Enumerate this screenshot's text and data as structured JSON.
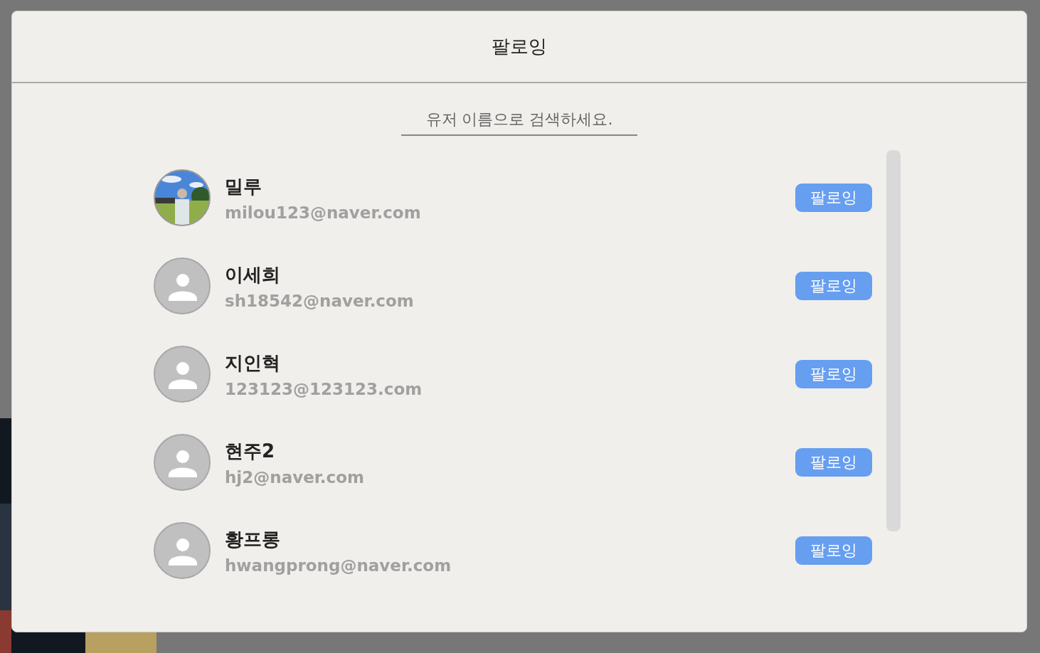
{
  "dialog": {
    "title": "팔로잉"
  },
  "search": {
    "placeholder": "유저 이름으로 검색하세요."
  },
  "users": [
    {
      "name": "밀루",
      "email": "milou123@naver.com",
      "button": "팔로잉"
    },
    {
      "kind": "default",
      "name": "이세희",
      "email": "sh18542@naver.com",
      "button": "팔로잉"
    },
    {
      "kind": "default",
      "name": "지인혁",
      "email": "123123@123123.com",
      "button": "팔로잉"
    },
    {
      "kind": "default",
      "name": "현주2",
      "email": "hj2@naver.com",
      "button": "팔로잉"
    },
    {
      "kind": "default",
      "name": "황프롱",
      "email": "hwangprong@naver.com",
      "button": "팔로잉"
    }
  ]
}
